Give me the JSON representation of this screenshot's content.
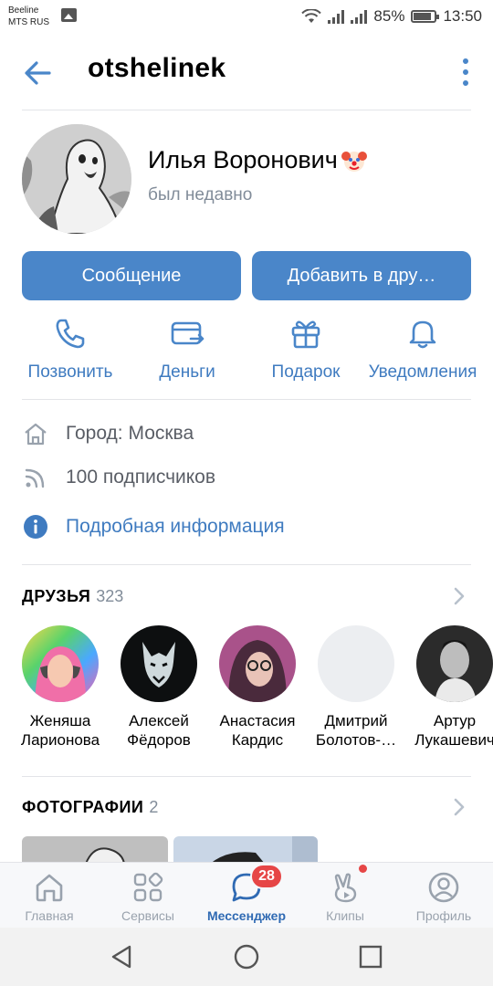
{
  "status_bar": {
    "carrier1": "Beeline",
    "carrier2": "MTS RUS",
    "battery": "85%",
    "time": "13:50"
  },
  "header": {
    "screen_name": "otshelinek"
  },
  "profile": {
    "name": "Илья Воронович",
    "status": "был недавно",
    "message_button": "Сообщение",
    "add_friend_button": "Добавить в дру…"
  },
  "actions": [
    {
      "label": "Позвонить",
      "icon": "phone-icon"
    },
    {
      "label": "Деньги",
      "icon": "money-card-icon"
    },
    {
      "label": "Подарок",
      "icon": "gift-icon"
    },
    {
      "label": "Уведомления",
      "icon": "bell-icon"
    }
  ],
  "info": {
    "city": "Город: Москва",
    "followers": "100 подписчиков",
    "details_link": "Подробная информация"
  },
  "friends": {
    "title": "ДРУЗЬЯ",
    "count": "323",
    "items": [
      {
        "first": "Женяша",
        "last": "Ларионова"
      },
      {
        "first": "Алексей",
        "last": "Фёдоров"
      },
      {
        "first": "Анастасия",
        "last": "Кардис"
      },
      {
        "first": "Дмитрий",
        "last": "Болотов-…"
      },
      {
        "first": "Артур",
        "last": "Лукашевич"
      }
    ]
  },
  "photos": {
    "title": "ФОТОГРАФИИ",
    "count": "2"
  },
  "tabbar": {
    "items": [
      {
        "label": "Главная",
        "icon": "home-icon"
      },
      {
        "label": "Сервисы",
        "icon": "services-grid-icon"
      },
      {
        "label": "Мессенджер",
        "icon": "messenger-icon"
      },
      {
        "label": "Клипы",
        "icon": "clips-icon"
      },
      {
        "label": "Профиль",
        "icon": "profile-icon"
      }
    ],
    "messenger_badge": "28"
  },
  "colors": {
    "accent": "#4a86c9",
    "link": "#3f7bc0",
    "badge": "#e64646",
    "secondary_text": "#818c99"
  }
}
